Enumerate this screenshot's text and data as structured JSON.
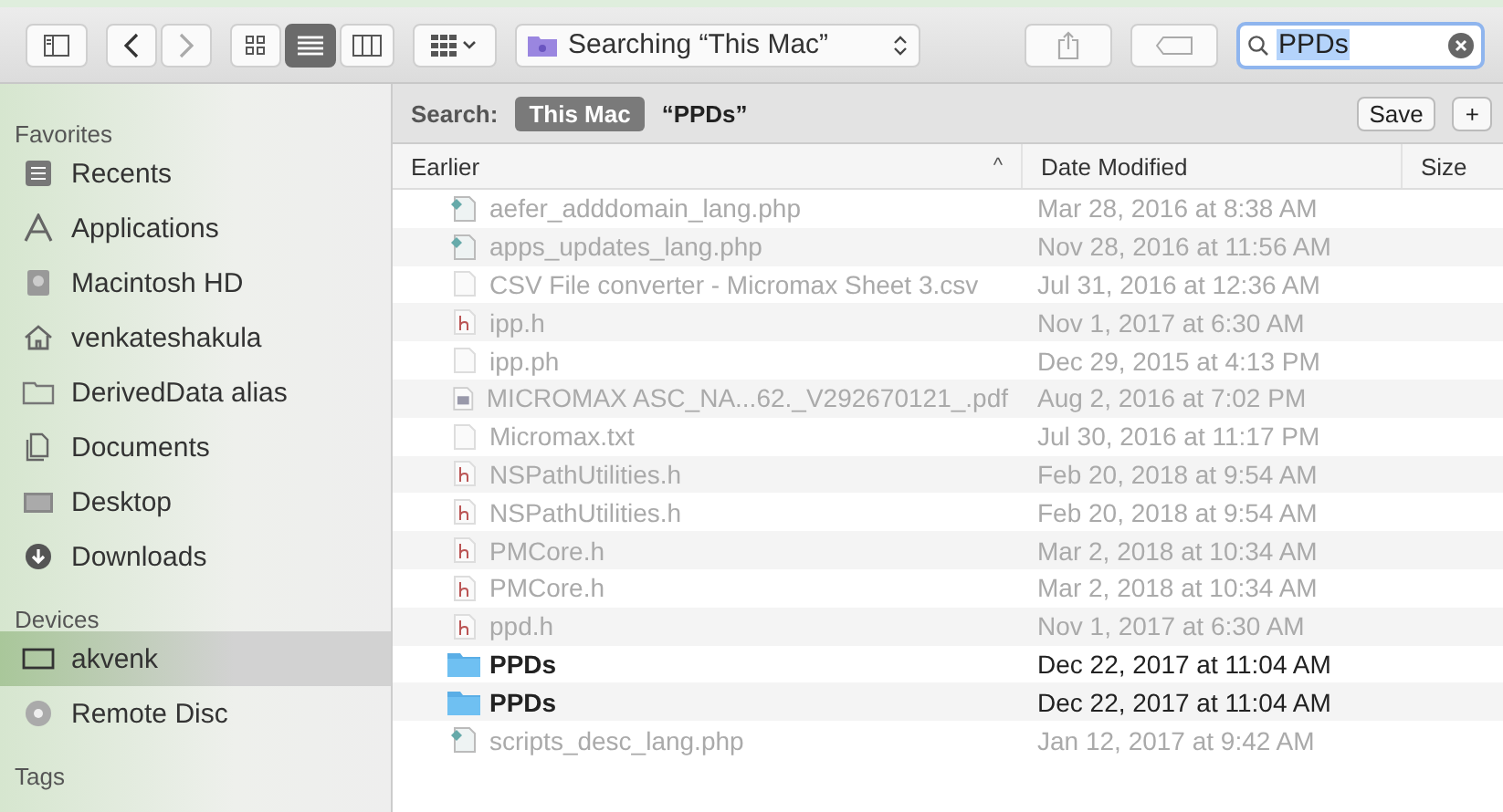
{
  "toolbar": {
    "view_modes": [
      {
        "kind": "icons",
        "selected": false
      },
      {
        "kind": "list",
        "selected": true
      },
      {
        "kind": "columns",
        "selected": false
      }
    ],
    "location": "Searching “This Mac”",
    "search": {
      "value": "PPDs"
    }
  },
  "sidebar": {
    "sections": [
      {
        "title": "Favorites",
        "items": [
          {
            "label": "Recents",
            "kind": "recents",
            "selected": false
          },
          {
            "label": "Applications",
            "kind": "apps",
            "selected": false
          },
          {
            "label": "Macintosh HD",
            "kind": "disk",
            "selected": false
          },
          {
            "label": "venkateshakula",
            "kind": "home",
            "selected": false
          },
          {
            "label": "DerivedData alias",
            "kind": "folder",
            "selected": false
          },
          {
            "label": "Documents",
            "kind": "docs",
            "selected": false
          },
          {
            "label": "Desktop",
            "kind": "desktop",
            "selected": false
          },
          {
            "label": "Downloads",
            "kind": "downloads",
            "selected": false
          }
        ]
      },
      {
        "title": "Devices",
        "items": [
          {
            "label": "akvenk",
            "kind": "laptop",
            "selected": true
          },
          {
            "label": "Remote Disc",
            "kind": "disc",
            "selected": false
          }
        ]
      },
      {
        "title": "Tags"
      }
    ]
  },
  "search_bar": {
    "label": "Search:",
    "scope": "This Mac",
    "query": "“PPDs”",
    "buttons": [
      "Save",
      "+"
    ]
  },
  "table": {
    "columns": [
      {
        "label": "Earlier",
        "sorted": true
      },
      {
        "label": "Date Modified",
        "sorted": false
      },
      {
        "label": "Size",
        "sorted": false
      }
    ],
    "sort_glyph": "^",
    "rows": [
      {
        "name": "aefer_adddomain_lang.php",
        "date": "Mar 28, 2016 at 8:38 AM",
        "kind": "php"
      },
      {
        "name": "apps_updates_lang.php",
        "date": "Nov 28, 2016 at 11:56 AM",
        "kind": "php"
      },
      {
        "name": "CSV File converter - Micromax Sheet 3.csv",
        "date": "Jul 31, 2016 at 12:36 AM",
        "kind": "doc"
      },
      {
        "name": "ipp.h",
        "date": "Nov 1, 2017 at 6:30 AM",
        "kind": "h"
      },
      {
        "name": "ipp.ph",
        "date": "Dec 29, 2015 at 4:13 PM",
        "kind": "doc"
      },
      {
        "name": "MICROMAX ASC_NA...62._V292670121_.pdf",
        "date": "Aug 2, 2016 at 7:02 PM",
        "kind": "pdf"
      },
      {
        "name": "Micromax.txt",
        "date": "Jul 30, 2016 at 11:17 PM",
        "kind": "doc"
      },
      {
        "name": "NSPathUtilities.h",
        "date": "Feb 20, 2018 at 9:54 AM",
        "kind": "h"
      },
      {
        "name": "NSPathUtilities.h",
        "date": "Feb 20, 2018 at 9:54 AM",
        "kind": "h"
      },
      {
        "name": "PMCore.h",
        "date": "Mar 2, 2018 at 10:34 AM",
        "kind": "h"
      },
      {
        "name": "PMCore.h",
        "date": "Mar 2, 2018 at 10:34 AM",
        "kind": "h"
      },
      {
        "name": "ppd.h",
        "date": "Nov 1, 2017 at 6:30 AM",
        "kind": "h"
      },
      {
        "name": "PPDs",
        "date": "Dec 22, 2017 at 11:04 AM",
        "kind": "folder"
      },
      {
        "name": "PPDs",
        "date": "Dec 22, 2017 at 11:04 AM",
        "kind": "folder"
      },
      {
        "name": "scripts_desc_lang.php",
        "date": "Jan 12, 2017 at 9:42 AM",
        "kind": "php"
      }
    ]
  }
}
